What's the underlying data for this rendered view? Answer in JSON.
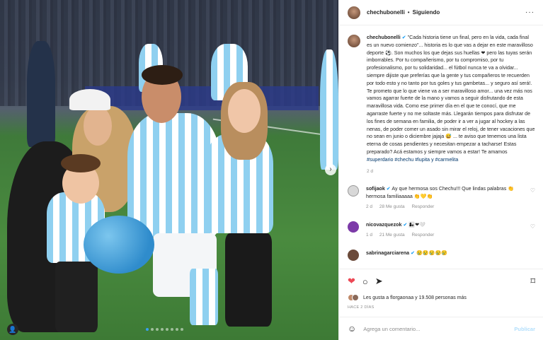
{
  "post": {
    "username": "chechubonelli",
    "follow_label": "Siguiendo",
    "more": "···",
    "caption": "\"Cada historia tiene un final, pero en la vida, cada final es un nuevo comienzo\"... historia es lo que vas a dejar en este maravilloso deporte ⚽. Son muchos los que dejas sus huellas ❤ pero las tuyas serán imborrables. Por tu compañerismo, por tu compromiso, por tu profesionalismo, por tu solidaridad... el fútbol nunca te va a olvidar... siempre dijiste que preferías que la gente y tus compañeros te recuerden por todo esto y no tanto por tus goles y tus gambetas... y seguro así será!. Te prometo que lo que viene va a ser maravilloso amor... una vez más nos vamos agarrar fuerte de la mano y vamos a seguir disfrutando de esta maravillosa vida. Como ese primer día en el que te conocí, que me agarraste fuerte y no me soltaste más. Llegarán tiempos para disfrutar de los fines de semana en familia, de poder ir a ver a jugar al hockey a las nenas, de poder comer un asado sin mirar el reloj, de tener vacaciones que no sean en junio o diciembre jajaja 😅 ... te aviso que tenemos una lista eterna de cosas pendientes y necesitan empezar a tacharse! Estas preparado? Acá estamos y siempre vamos a estar! Te amamos",
    "hashtags": "#superdario #chechu #lupita y #carmelita",
    "caption_age": "2 d"
  },
  "comments": [
    {
      "user": "sofijaok",
      "text": "Ay que hermosa sos Chechu!!! Que lindas palabras 👏 hermosa familiaaaaa 👏💛👏",
      "age": "2 d",
      "likes": "28 Me gusta",
      "reply": "Responder",
      "avatar_color": "#d8d8d8"
    },
    {
      "user": "nicovazquezok",
      "text": "👩‍👧❤🤍",
      "age": "1 d",
      "likes": "21 Me gusta",
      "reply": "Responder",
      "avatar_color": "#7c3aa8"
    },
    {
      "user": "sabrinagarciarena",
      "text": "😢😢😢😢😢",
      "age": "",
      "likes": "",
      "reply": "",
      "avatar_color": "#6b4a3a"
    }
  ],
  "actions": {
    "like_icon": "heart-filled-icon",
    "comment_icon": "comment-icon",
    "share_icon": "share-icon",
    "save_icon": "bookmark-icon",
    "likes_text": "Les gusta a florgaonaa y 19.508 personas más",
    "time_ago": "HACE 2 DÍAS"
  },
  "composer": {
    "emoji": "☺",
    "placeholder": "Agrega un comentario...",
    "publish": "Publicar"
  },
  "colors": {
    "accent_blue": "#0095f6",
    "like_red": "#ed4956"
  },
  "carousel": {
    "current": 1,
    "total": 8
  }
}
